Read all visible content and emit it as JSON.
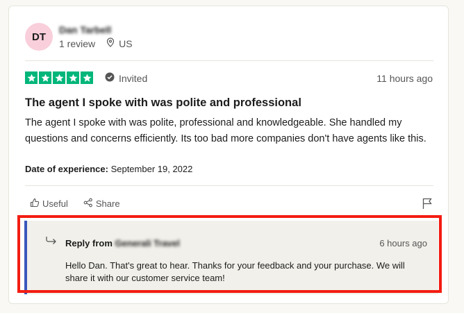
{
  "reviewer": {
    "initials": "DT",
    "name": "Dan Tarbell",
    "review_count": "1 review",
    "country": "US"
  },
  "review": {
    "rating": 5,
    "rating_color": "#00b67a",
    "invited_label": "Invited",
    "time_ago": "11 hours ago",
    "title": "The agent I spoke with was polite and professional",
    "body": "The agent I spoke with was polite, professional and knowledgeable. She handled my questions and concerns efficiently. Its too bad more companies don't have agents like this.",
    "date_label": "Date of experience:",
    "date_value": "September 19, 2022"
  },
  "actions": {
    "useful_label": "Useful",
    "share_label": "Share"
  },
  "reply": {
    "from_label": "Reply from",
    "company": "Generali Travel",
    "time_ago": "6 hours ago",
    "text": "Hello Dan. That's great to hear. Thanks for your feedback and your purchase. We will share it with our customer service team!",
    "accent_color": "#3c57bc",
    "highlight_color": "#f31d12"
  }
}
